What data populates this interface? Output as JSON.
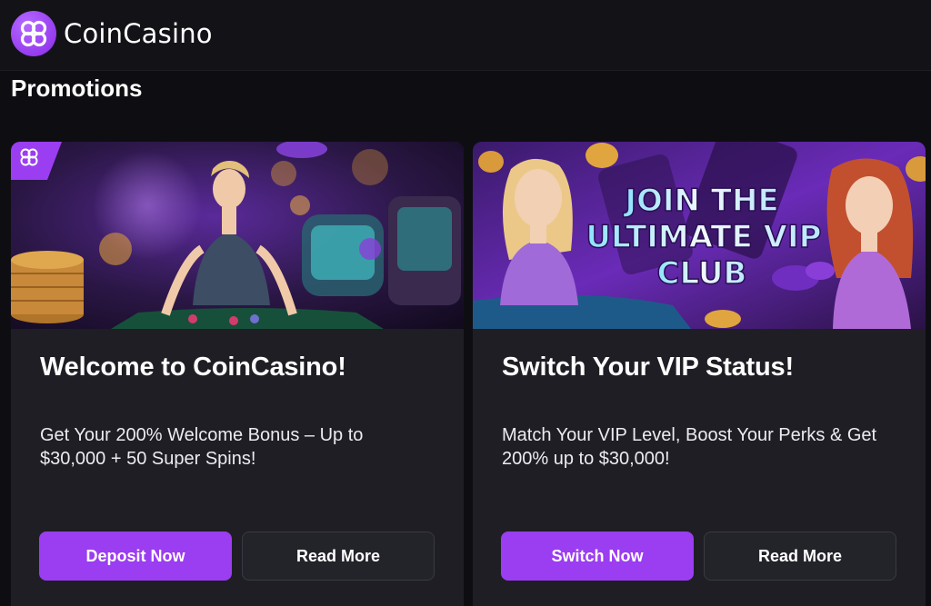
{
  "brand": {
    "name": "CoinCasino",
    "accent": "#9b3df0"
  },
  "page": {
    "title": "Promotions"
  },
  "promotions": [
    {
      "banner_icon": "casino-dealer-banner",
      "title": "Welcome to CoinCasino!",
      "description": "Get Your 200% Welcome Bonus – Up to $30,000 + 50 Super Spins!",
      "primary_label": "Deposit Now",
      "secondary_label": "Read More"
    },
    {
      "banner_icon": "vip-club-banner",
      "banner_text": [
        "JOIN THE",
        "ULTIMATE VIP",
        "CLUB"
      ],
      "title": "Switch Your VIP Status!",
      "description": "Match Your VIP Level, Boost Your Perks & Get 200% up to $30,000!",
      "primary_label": "Switch Now",
      "secondary_label": "Read More"
    }
  ]
}
